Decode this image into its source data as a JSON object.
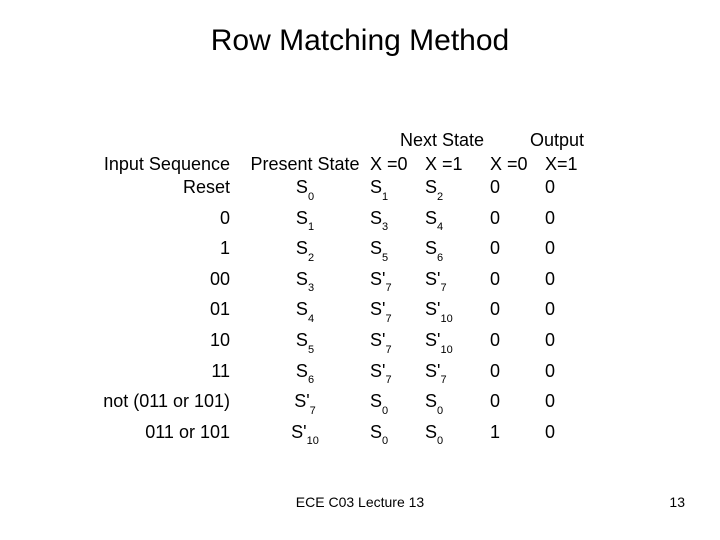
{
  "title": "Row Matching Method",
  "group_headers": {
    "next_state": "Next State",
    "output": "Output"
  },
  "col_headers": {
    "input": "Input Sequence",
    "present": "Present State",
    "x0": "X =0",
    "x1": "X =1",
    "out0": "X =0",
    "out1": "X=1"
  },
  "rows": [
    {
      "input": "Reset",
      "present": {
        "s": "S",
        "sub": "0"
      },
      "x0": {
        "s": "S",
        "sub": "1"
      },
      "x1": {
        "s": "S",
        "sub": "2"
      },
      "out0": "0",
      "out1": "0"
    },
    {
      "input": "0",
      "present": {
        "s": "S",
        "sub": "1"
      },
      "x0": {
        "s": "S",
        "sub": "3"
      },
      "x1": {
        "s": "S",
        "sub": "4"
      },
      "out0": "0",
      "out1": "0"
    },
    {
      "input": "1",
      "present": {
        "s": "S",
        "sub": "2"
      },
      "x0": {
        "s": "S",
        "sub": "5"
      },
      "x1": {
        "s": "S",
        "sub": "6"
      },
      "out0": "0",
      "out1": "0"
    },
    {
      "input": "00",
      "present": {
        "s": "S",
        "sub": "3"
      },
      "x0": {
        "s": "S'",
        "sub": "7"
      },
      "x1": {
        "s": "S'",
        "sub": "7"
      },
      "out0": "0",
      "out1": "0"
    },
    {
      "input": "01",
      "present": {
        "s": "S",
        "sub": "4"
      },
      "x0": {
        "s": "S'",
        "sub": "7"
      },
      "x1": {
        "s": "S'",
        "sub": "10"
      },
      "out0": "0",
      "out1": "0"
    },
    {
      "input": "10",
      "present": {
        "s": "S",
        "sub": "5"
      },
      "x0": {
        "s": "S'",
        "sub": "7"
      },
      "x1": {
        "s": "S'",
        "sub": "10"
      },
      "out0": "0",
      "out1": "0"
    },
    {
      "input": "11",
      "present": {
        "s": "S",
        "sub": "6"
      },
      "x0": {
        "s": "S'",
        "sub": "7"
      },
      "x1": {
        "s": "S'",
        "sub": "7"
      },
      "out0": "0",
      "out1": "0"
    },
    {
      "input": "not (011 or 101)",
      "present": {
        "s": "S'",
        "sub": "7"
      },
      "x0": {
        "s": "S",
        "sub": "0"
      },
      "x1": {
        "s": "S",
        "sub": "0"
      },
      "out0": "0",
      "out1": "0"
    },
    {
      "input": "011 or 101",
      "present": {
        "s": "S'",
        "sub": "10"
      },
      "x0": {
        "s": "S",
        "sub": "0"
      },
      "x1": {
        "s": "S",
        "sub": "0"
      },
      "out0": "1",
      "out1": "0"
    }
  ],
  "footer": {
    "center": "ECE C03 Lecture 13",
    "page": "13"
  }
}
